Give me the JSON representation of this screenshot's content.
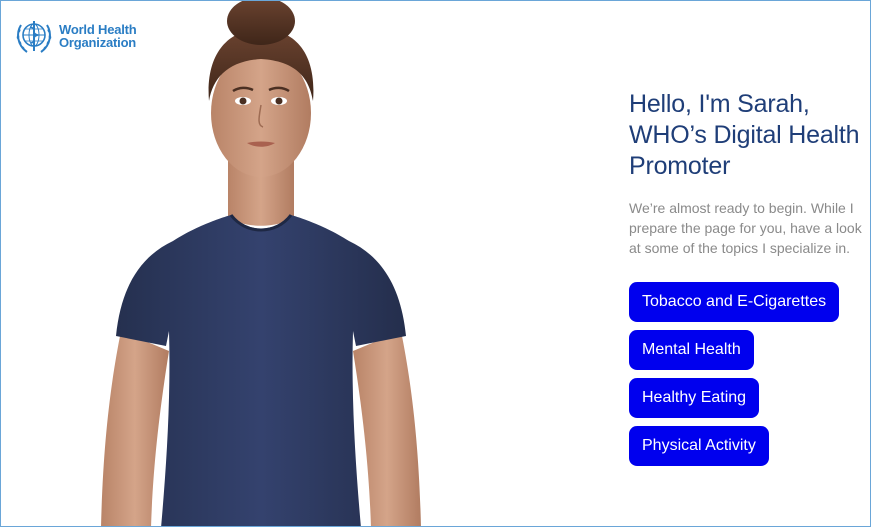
{
  "logo": {
    "line1": "World Health",
    "line2": "Organization"
  },
  "headline": {
    "line1": "Hello, I'm Sarah,",
    "line2": "WHO’s Digital Health",
    "line3": "Promoter"
  },
  "intro": {
    "line1": "We’re almost ready to begin. While I",
    "line2": "prepare the page for you, have a look",
    "line3": "at some of the topics I specialize in."
  },
  "topics": [
    {
      "label": "Tobacco and E-Cigarettes"
    },
    {
      "label": "Mental Health"
    },
    {
      "label": "Healthy Eating"
    },
    {
      "label": "Physical Activity"
    }
  ],
  "colors": {
    "brand_blue": "#2a7dc4",
    "headline": "#1f3e78",
    "button": "#0000ee",
    "shirt": "#2e3b63",
    "skin": "#c99a7f",
    "hair": "#5a3826"
  }
}
